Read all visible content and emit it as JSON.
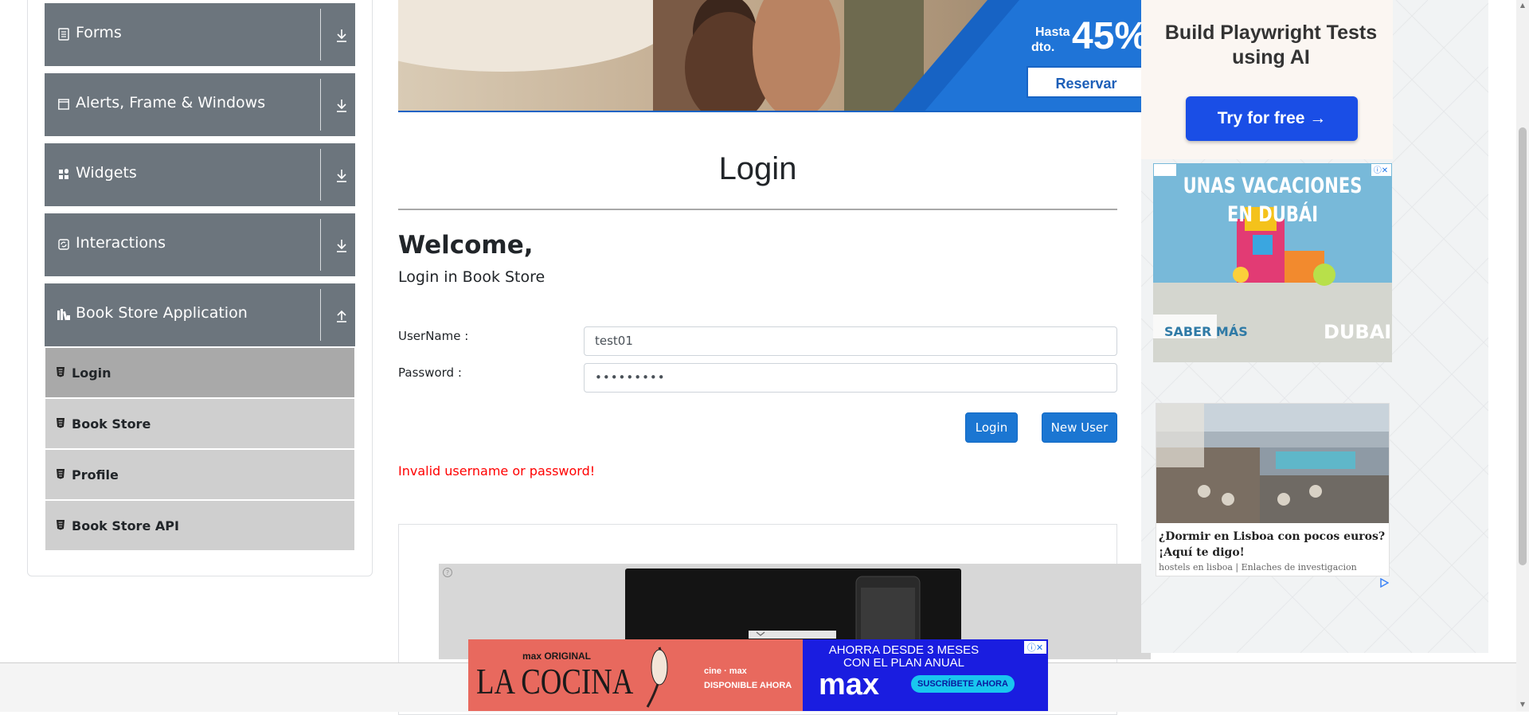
{
  "sidebar": {
    "groups": [
      {
        "label": "Forms",
        "icon": "form-icon",
        "arrow": "download-arrow-icon"
      },
      {
        "label": "Alerts, Frame & Windows",
        "icon": "window-icon",
        "arrow": "download-arrow-icon"
      },
      {
        "label": "Widgets",
        "icon": "widgets-icon",
        "arrow": "download-arrow-icon"
      },
      {
        "label": "Interactions",
        "icon": "interactions-icon",
        "arrow": "download-arrow-icon"
      },
      {
        "label": "Book Store Application",
        "icon": "books-icon",
        "arrow": "upload-arrow-icon"
      }
    ],
    "items": [
      {
        "label": "Login",
        "icon": "html-icon",
        "active": true
      },
      {
        "label": "Book Store",
        "icon": "html-icon",
        "active": false
      },
      {
        "label": "Profile",
        "icon": "html-icon",
        "active": false
      },
      {
        "label": "Book Store API",
        "icon": "html-icon",
        "active": false
      }
    ]
  },
  "top_banner": {
    "text_hasta": "Hasta",
    "text_dto": "dto.",
    "percent": "45%",
    "button": "Reservar"
  },
  "main": {
    "title": "Login",
    "welcome": "Welcome,",
    "subtitle": "Login in Book Store",
    "username_label": "UserName :",
    "username_value": "test01",
    "password_label": "Password :",
    "password_value": "•••••••••",
    "login_button": "Login",
    "new_user_button": "New User",
    "error": "Invalid username or password!"
  },
  "ads": {
    "playwright": {
      "title": "Build Playwright Tests using AI",
      "button": "Try for free →"
    },
    "dubai": {
      "headline_1": "UNAS VACACIONES",
      "headline_2": "EN DUBÁI",
      "cta": "SABER MÁS",
      "brand": "DUBAI"
    },
    "lisboa": {
      "title": "¿Dormir en Lisboa con pocos euros? ¡Aquí te digo!",
      "source": "hostels en lisboa | Enlaches de investigacion"
    },
    "max": {
      "tag": "max ORIGINAL",
      "show": "LA COCINA",
      "available": "DISPONIBLE AHORA",
      "cine": "cine · max",
      "offer_1": "AHORRA DESDE 3 MESES",
      "offer_2": "CON EL PLAN ANUAL",
      "logo": "max",
      "cta": "SUSCRÍBETE AHORA"
    }
  },
  "colors": {
    "sidebar_group": "#6c757d",
    "sidebar_item": "#cfcfcf",
    "sidebar_item_active": "#a9a9a9",
    "primary_button": "#1b76d2",
    "error": "#ff0000"
  }
}
